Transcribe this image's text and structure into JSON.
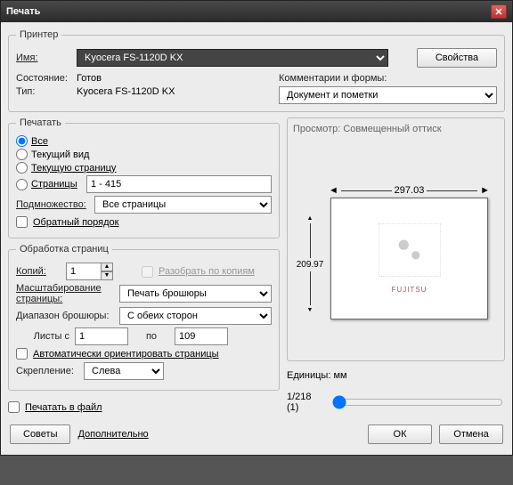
{
  "window": {
    "title": "Печать"
  },
  "printer": {
    "legend": "Принтер",
    "name_label": "Имя:",
    "name_value": "Kyocera FS-1120D KX",
    "properties_btn": "Свойства",
    "status_label": "Состояние:",
    "status_value": "Готов",
    "type_label": "Тип:",
    "type_value": "Kyocera FS-1120D KX",
    "comments_label": "Комментарии и формы:",
    "comments_value": "Документ и пометки"
  },
  "range": {
    "legend": "Печатать",
    "all": "Все",
    "current_view": "Текущий вид",
    "current_page": "Текущую страницу",
    "pages_label": "Страницы",
    "pages_value": "1 - 415",
    "subset_label": "Подмножество:",
    "subset_value": "Все страницы",
    "reverse": "Обратный порядок"
  },
  "handling": {
    "legend": "Обработка страниц",
    "copies_label": "Копий:",
    "copies_value": "1",
    "collate": "Разобрать по копиям",
    "scaling_label": "Масштабирование страницы:",
    "scaling_value": "Печать брошюры",
    "booklet_label": "Диапазон брошюры:",
    "booklet_value": "С обеих сторон",
    "sheets_from": "Листы с",
    "sheets_from_value": "1",
    "sheets_to": "по",
    "sheets_to_value": "109",
    "auto_rotate": "Автоматически ориентировать страницы",
    "binding_label": "Скрепление:",
    "binding_value": "Слева"
  },
  "print_to_file": "Печатать в файл",
  "preview": {
    "title": "Просмотр: Совмещенный оттиск",
    "width": "297.03",
    "height": "209.97",
    "logo": "FUJITSU",
    "units": "Единицы: мм",
    "page_indicator": "1/218 (1)"
  },
  "footer": {
    "tips": "Советы",
    "advanced": "Дополнительно",
    "ok": "ОК",
    "cancel": "Отмена"
  }
}
